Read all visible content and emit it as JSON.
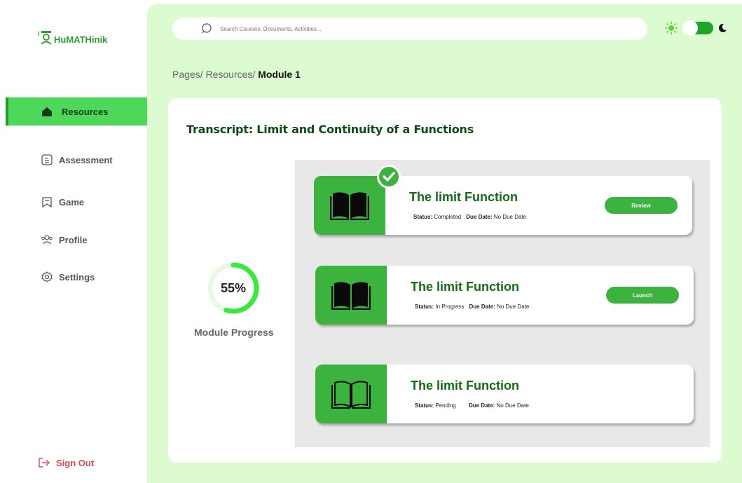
{
  "app": {
    "logo_text": "HuMATHinik"
  },
  "sidebar": {
    "items": [
      {
        "label": "Resources",
        "icon": "home-icon",
        "active": true
      },
      {
        "label": "Assessment",
        "icon": "assessment-icon",
        "active": false
      },
      {
        "label": "Game",
        "icon": "game-icon",
        "active": false
      },
      {
        "label": "Profile",
        "icon": "profile-icon",
        "active": false
      },
      {
        "label": "Settings",
        "icon": "gear-icon",
        "active": false
      }
    ],
    "signout_label": "Sign Out"
  },
  "search": {
    "placeholder": "Search Courses, Documents, Activities..."
  },
  "theme": {
    "light_icon": "sun-icon",
    "dark_icon": "moon-icon"
  },
  "breadcrumb": {
    "prefix": "Pages/ Resources/ ",
    "current": "Module 1"
  },
  "page": {
    "title": "Transcript: Limit and Continuity of a Functions"
  },
  "progress": {
    "value": 55,
    "display": "55%",
    "label": "Module Progress"
  },
  "lessons": [
    {
      "title": "The limit Function",
      "status_label": "Status:",
      "status": "Completed",
      "due_label": "Due Date:",
      "due": "No Due Date",
      "button": "Review",
      "completed": true
    },
    {
      "title": "The limit Function",
      "status_label": "Status:",
      "status": "In Progress",
      "due_label": "Due Date:",
      "due": "No Due Date",
      "button": "Launch",
      "completed": false
    },
    {
      "title": "The limit Function",
      "status_label": "Status:",
      "status": "Pending",
      "due_label": "Due Date:",
      "due": "No Due Date",
      "button": "",
      "completed": false
    }
  ],
  "colors": {
    "accent": "#3db33f",
    "bg_main": "#dcfbd0",
    "title": "#0f4a12",
    "signout": "#e0484a"
  }
}
